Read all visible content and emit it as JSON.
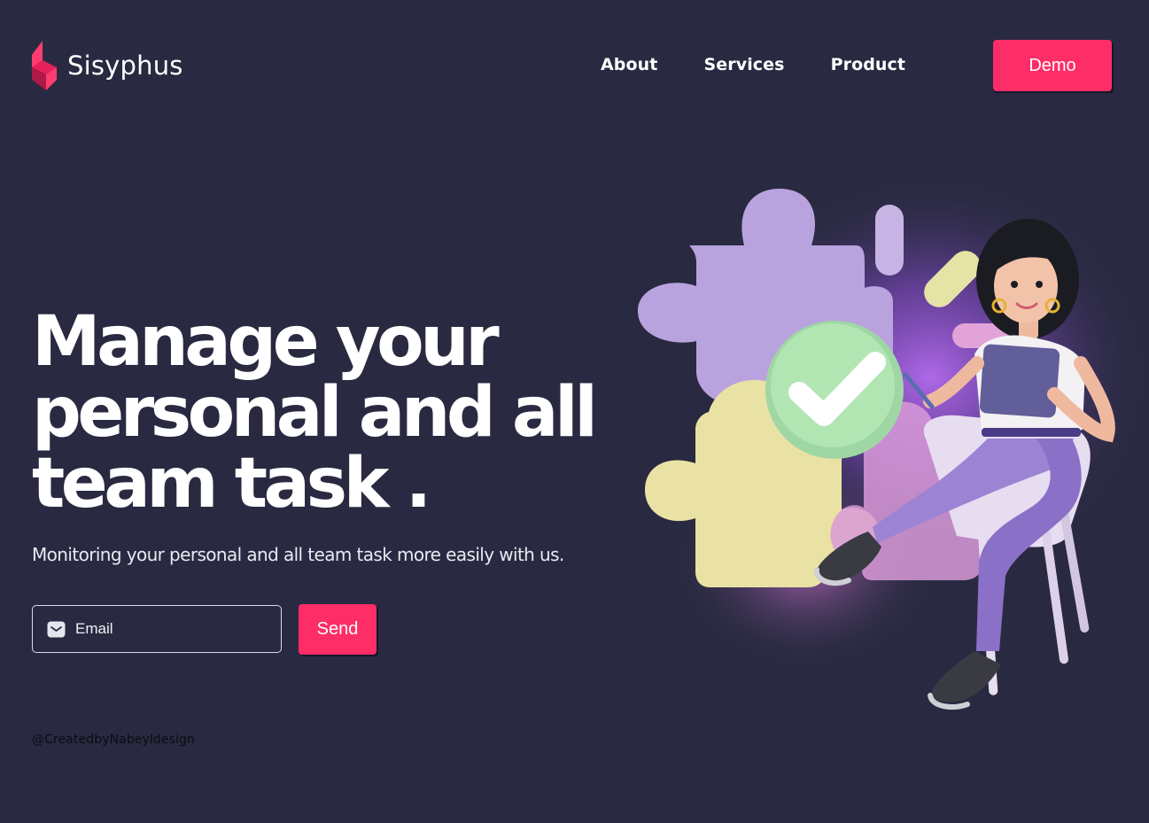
{
  "brand": {
    "name": "Sisyphus",
    "accent_color": "#fd2d67",
    "background_color": "#292a41"
  },
  "nav": {
    "items": [
      {
        "label": "About"
      },
      {
        "label": "Services"
      },
      {
        "label": "Product"
      }
    ],
    "cta_label": "Demo"
  },
  "hero": {
    "headline_line1": "Manage your",
    "headline_line2": "personal and all",
    "headline_line3": "team task .",
    "subheadline": "Monitoring your personal and all team task more easily with us.",
    "email_placeholder": "Email",
    "email_icon": "mail-icon",
    "send_label": "Send"
  },
  "illustration": {
    "icon": "check-mark-icon"
  },
  "footer": {
    "credit": "@CreatedbyNabeyldesign"
  }
}
